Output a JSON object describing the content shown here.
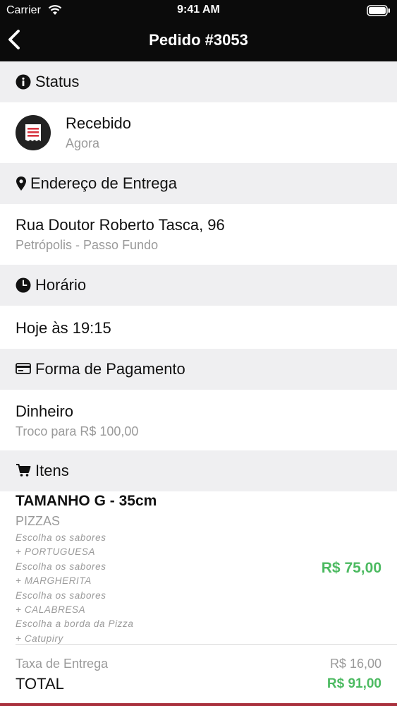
{
  "status_bar": {
    "carrier": "Carrier",
    "time": "9:41 AM"
  },
  "nav": {
    "title": "Pedido #3053",
    "back_icon": "chevron-left-icon"
  },
  "status_section": {
    "header": "Status",
    "icon": "info-icon",
    "value": "Recebido",
    "sub": "Agora",
    "avatar_icon": "receipt-icon",
    "avatar_accent": "#d7343f"
  },
  "address_section": {
    "header": "Endereço de Entrega",
    "icon": "location-pin-icon",
    "street": "Rua Doutor Roberto Tasca, 96",
    "district": "Petrópolis - Passo Fundo"
  },
  "time_section": {
    "header": "Horário",
    "icon": "clock-icon",
    "value": "Hoje às 19:15"
  },
  "payment_section": {
    "header": "Forma de Pagamento",
    "icon": "credit-card-icon",
    "method": "Dinheiro",
    "change": "Troco para R$ 100,00"
  },
  "items_section": {
    "header": "Itens",
    "icon": "cart-icon",
    "items": [
      {
        "title": "TAMANHO G - 35cm",
        "category": "PIZZAS",
        "options": [
          "Escolha os sabores",
          "+ PORTUGUESA",
          "Escolha os sabores",
          "+ MARGHERITA",
          "Escolha os sabores",
          "+ CALABRESA",
          "Escolha a borda da Pizza",
          "+ Catupiry"
        ],
        "price": "R$ 75,00"
      }
    ]
  },
  "totals": {
    "delivery_label": "Taxa de Entrega",
    "delivery_value": "R$ 16,00",
    "total_label": "TOTAL",
    "total_value": "R$ 91,00"
  },
  "colors": {
    "nav_bg": "#0b0b0b",
    "section_bg": "#efeff1",
    "price_green": "#4cba61",
    "accent_red": "#a9313d"
  }
}
